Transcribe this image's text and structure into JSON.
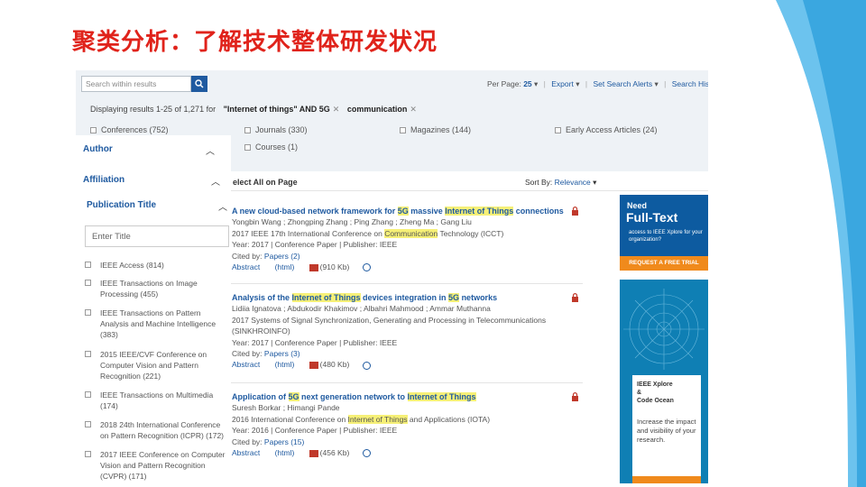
{
  "slide": {
    "title": "聚类分析：了解技术整体研发状况"
  },
  "topbar": {
    "search_placeholder": "Search within results",
    "per_page_label": "Per Page:",
    "per_page_value": "25",
    "export": "Export",
    "set_alerts": "Set Search Alerts",
    "search_history": "Search Histo"
  },
  "results_summary": {
    "text": "Displaying results 1-25 of 1,271 for",
    "terms": [
      "\"Internet of things\" AND 5G",
      "communication"
    ]
  },
  "content_types": [
    {
      "label": "Conferences (752)"
    },
    {
      "label": "Journals (330)"
    },
    {
      "label": "Magazines (144)"
    },
    {
      "label": "Early Access Articles (24)"
    },
    {
      "label": "Courses (1)"
    }
  ],
  "sidebar": {
    "author": "Author",
    "affiliation": "Affiliation",
    "publication_title": "Publication Title",
    "enter_title_placeholder": "Enter Title",
    "pub_items": [
      "IEEE Access (814)",
      "IEEE Transactions on Image Processing (455)",
      "IEEE Transactions on Pattern Analysis and Machine Intelligence (383)",
      "2015 IEEE/CVF Conference on Computer Vision and Pattern Recognition (221)",
      "IEEE Transactions on Multimedia (174)",
      "2018 24th International Conference on Pattern Recognition (ICPR) (172)",
      "2017 IEEE Conference on Computer Vision and Pattern Recognition (CVPR) (171)"
    ]
  },
  "results_header": {
    "select_all": "elect All on Page",
    "sort_by": "Sort By:",
    "sort_value": "Relevance"
  },
  "results": [
    {
      "title_parts": [
        "A new cloud-based network framework for ",
        "5G",
        " massive ",
        "Internet of Things",
        " connections"
      ],
      "authors": "Yongbin Wang ; Zhongping Zhang ; Ping Zhang ; Zheng Ma ; Gang Liu",
      "conf_parts": [
        "2017 IEEE 17th International Conference on ",
        "Communication",
        " Technology (ICCT)"
      ],
      "meta": "Year: 2017 | Conference Paper | Publisher: IEEE",
      "cited_label": "Cited by:",
      "cited_value": "Papers (2)",
      "abstract": "Abstract",
      "html": "(html)",
      "pdf_size": "(910 Kb)"
    },
    {
      "title_parts": [
        "Analysis of the ",
        "Internet of Things",
        " devices integration in ",
        "5G",
        " networks"
      ],
      "authors": "Lidiia Ignatova ; Abdukodir Khakimov ; Albahri Mahmood ; Ammar Muthanna",
      "conf_parts": [
        "2017 Systems of Signal Synchronization, Generating and Processing in Telecommunications (SINKHROINFO)"
      ],
      "meta": "Year: 2017 | Conference Paper | Publisher: IEEE",
      "cited_label": "Cited by:",
      "cited_value": "Papers (3)",
      "abstract": "Abstract",
      "html": "(html)",
      "pdf_size": "(480 Kb)"
    },
    {
      "title_parts": [
        "Application of ",
        "5G",
        " next generation network to ",
        "Internet of Things",
        ""
      ],
      "authors": "Suresh Borkar ; Himangi Pande",
      "conf_parts": [
        "2016 International Conference on ",
        "Internet of Things",
        " and Applications (IOTA)"
      ],
      "meta": "Year: 2016 | Conference Paper | Publisher: IEEE",
      "cited_label": "Cited by:",
      "cited_value": "Papers (15)",
      "abstract": "Abstract",
      "html": "(html)",
      "pdf_size": "(456 Kb)"
    }
  ],
  "ad_fulltext": {
    "need": "Need",
    "full_text": "Full-Text",
    "access_line": "access to IEEE Xplore for your organization?",
    "request": "REQUEST A FREE TRIAL"
  },
  "ad_codeocean": {
    "heading_lines": [
      "IEEE Xplore",
      "&",
      "Code Ocean"
    ],
    "body": "Increase the impact and visibility of your research."
  },
  "colors": {
    "title_red": "#e0231b",
    "ieee_blue": "#1f5aa0",
    "highlight": "#f6f077",
    "orange": "#f08a1c"
  }
}
